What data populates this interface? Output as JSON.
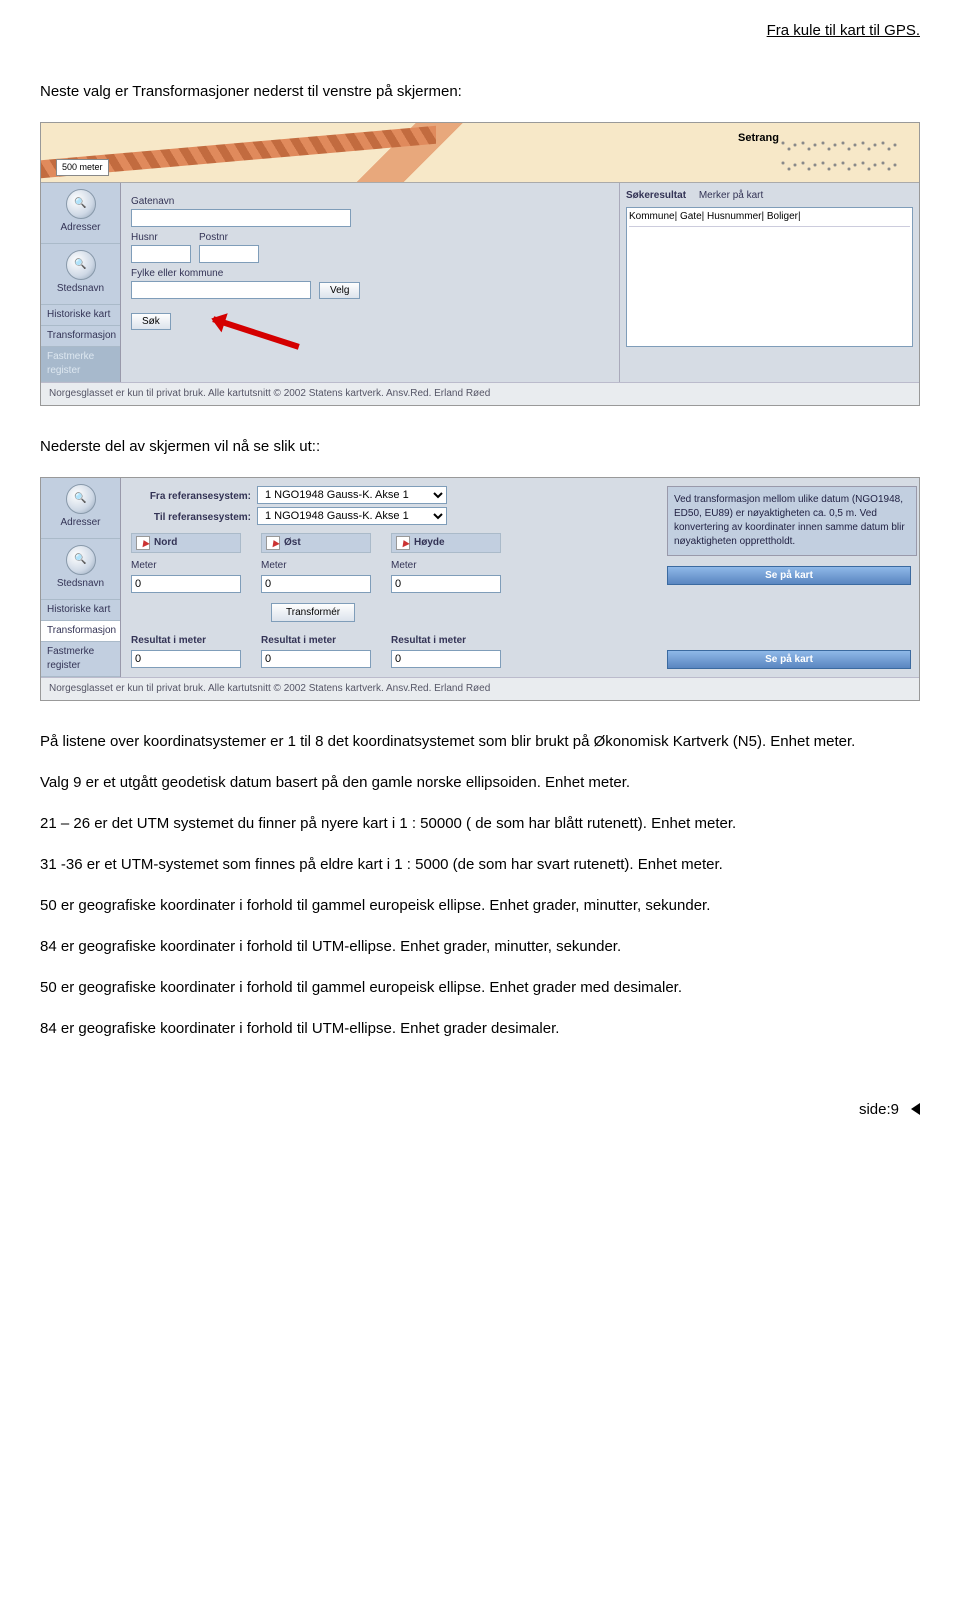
{
  "header_link": "Fra kule til kart til GPS.",
  "intro1": "Neste valg er Transformasjoner nederst til venstre på skjermen:",
  "intro2": "Nederste del av skjermen vil nå se slik ut::",
  "para_lead": "På listene over koordinatsystemer er 1 til 8 det koordinatsystemet som blir brukt på Økonomisk Kartverk (N5). Enhet meter.",
  "para9": "Valg 9 er et utgått geodetisk datum basert på den gamle norske ellipsoiden. Enhet meter.",
  "para21a": "21 – 26 er det UTM systemet du finner på nyere kart i 1 : 50000 ( de som har blått rutenett). Enhet meter.",
  "para31": "31 -36 er et UTM-systemet som finnes på eldre kart i 1 : 5000 (de som har svart rutenett). Enhet meter.",
  "para50a": "50 er geografiske koordinater i forhold til gammel europeisk ellipse. Enhet grader, minutter, sekunder.",
  "para84a": "84 er geografiske koordinater i forhold til UTM-ellipse. Enhet grader, minutter, sekunder.",
  "para50b": "50 er geografiske koordinater i forhold til gammel europeisk ellipse. Enhet grader med desimaler.",
  "para84b": "84 er geografiske koordinater i forhold til UTM-ellipse. Enhet grader desimaler.",
  "page_footer": "side:9",
  "shot1": {
    "map_label": "Setrang",
    "scale": "500 meter",
    "sidebar": {
      "adresser": "Adresser",
      "stedsnavn": "Stedsnavn",
      "historiske": "Historiske kart",
      "transformasjon": "Transformasjon",
      "fastmerke": "Fastmerke register"
    },
    "form": {
      "gatenavn": "Gatenavn",
      "husnr": "Husnr",
      "postnr": "Postnr",
      "fylke": "Fylke eller kommune",
      "velg": "Velg",
      "sok": "Søk"
    },
    "tabs": {
      "sokeresultat": "Søkeresultat",
      "merker": "Merker på kart"
    },
    "result_cols": "Kommune| Gate| Husnummer| Boliger|",
    "footer": "Norgesglasset er kun til privat bruk. Alle kartutsnitt © 2002 Statens kartverk. Ansv.Red. Erland Røed"
  },
  "shot2": {
    "sidebar": {
      "adresser": "Adresser",
      "stedsnavn": "Stedsnavn",
      "historiske": "Historiske kart",
      "transformasjon": "Transformasjon",
      "fastmerke": "Fastmerke register"
    },
    "from_label": "Fra referansesystem:",
    "to_label": "Til referansesystem:",
    "sys_option": "1 NGO1948 Gauss-K. Akse 1",
    "nord": "Nord",
    "ost": "Øst",
    "hoyde": "Høyde",
    "meter": "Meter",
    "zero": "0",
    "transform": "Transformér",
    "result": "Resultat i meter",
    "se_kart": "Se på kart",
    "info": "Ved transformasjon mellom ulike datum (NGO1948, ED50, EU89) er nøyaktigheten ca. 0,5 m. Ved konvertering av koordinater innen samme datum blir nøyaktigheten opprettholdt.",
    "footer": "Norgesglasset er kun til privat bruk. Alle kartutsnitt © 2002 Statens kartverk. Ansv.Red. Erland Røed"
  }
}
